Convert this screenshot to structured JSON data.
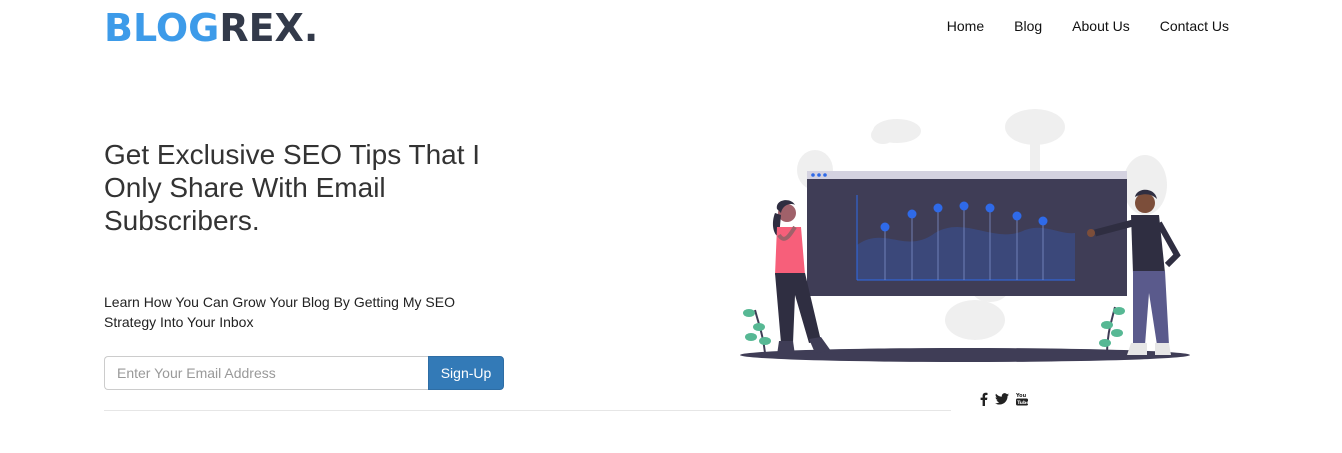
{
  "brand": {
    "part1": "BLOG",
    "part2": "REX",
    "dot": "."
  },
  "nav": {
    "items": [
      "Home",
      "Blog",
      "About Us",
      "Contact Us"
    ]
  },
  "hero": {
    "headline": "Get Exclusive SEO Tips That I Only Share With Email Subscribers.",
    "subtext": "Learn How You Can Grow Your Blog By Getting My SEO Strategy Into Your Inbox"
  },
  "signup": {
    "placeholder": "Enter Your Email Address",
    "value": "",
    "button_label": "Sign-Up"
  },
  "social": {
    "icons": [
      "facebook-icon",
      "twitter-icon",
      "youtube-icon"
    ]
  },
  "colors": {
    "logo_blue": "#3d9be9",
    "logo_dark": "#333a4a",
    "button": "#337ab7",
    "chart_dots": "#2f6ae8"
  }
}
